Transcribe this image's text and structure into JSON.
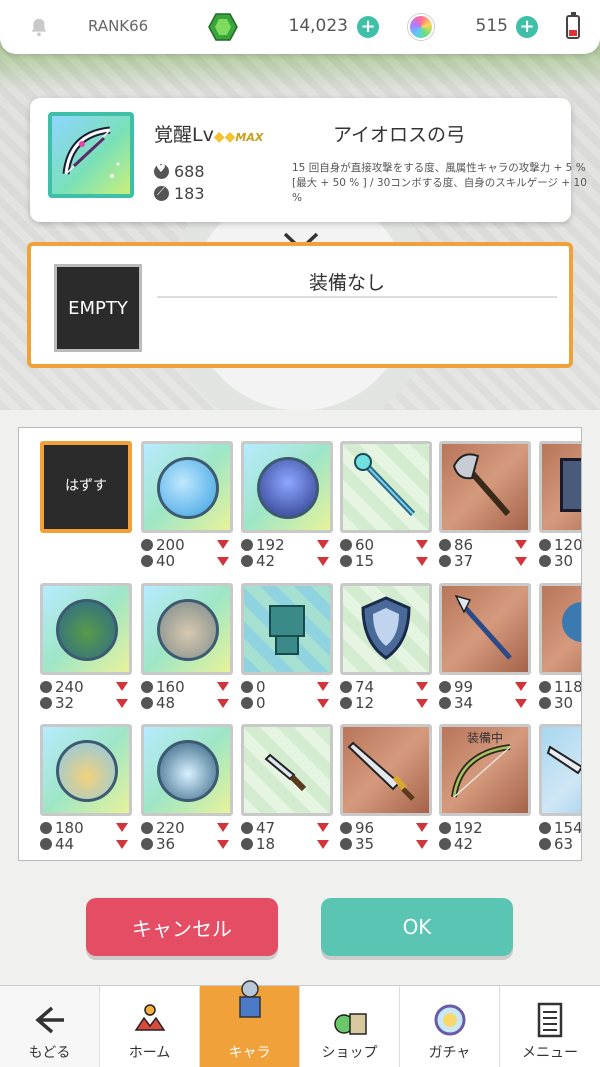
{
  "status_bar": {
    "rank_label": "RANK66",
    "gem_value": "14,023",
    "orb_value": "515",
    "plus_label": "+"
  },
  "item": {
    "awakening_prefix": "覚醒Lv",
    "awakening_max": "MAX",
    "name": "アイオロスの弓",
    "hp": "688",
    "attack": "183",
    "description": "15 回自身が直接攻撃をする度、風属性キャラの攻撃力 + 5 %[最大 + 50 % ] / 30コンボする度、自身のスキルゲージ + 10 %"
  },
  "equip_slot": {
    "empty_label": "EMPTY",
    "status": "装備なし"
  },
  "grid": {
    "remove_label": "はずす",
    "equipped_label": "装備中",
    "items": [
      {
        "hp": "200",
        "atk": "40"
      },
      {
        "hp": "192",
        "atk": "42"
      },
      {
        "hp": "60",
        "atk": "15"
      },
      {
        "hp": "86",
        "atk": "37"
      },
      {
        "hp": "120",
        "atk": "30"
      },
      {
        "hp": "240",
        "atk": "32"
      },
      {
        "hp": "160",
        "atk": "48"
      },
      {
        "hp": "0",
        "atk": "0"
      },
      {
        "hp": "74",
        "atk": "12"
      },
      {
        "hp": "99",
        "atk": "34"
      },
      {
        "hp": "118",
        "atk": "30"
      },
      {
        "hp": "180",
        "atk": "44"
      },
      {
        "hp": "220",
        "atk": "36"
      },
      {
        "hp": "47",
        "atk": "18"
      },
      {
        "hp": "96",
        "atk": "35"
      },
      {
        "hp": "192",
        "atk": "42"
      },
      {
        "hp": "154",
        "atk": "63"
      }
    ]
  },
  "buttons": {
    "cancel": "キャンセル",
    "ok": "OK"
  },
  "nav": {
    "back": "もどる",
    "home": "ホーム",
    "chara": "キャラ",
    "shop": "ショップ",
    "gacha": "ガチャ",
    "menu": "メニュー"
  },
  "colors": {
    "accent_orange": "#f0a13a",
    "teal": "#3fbfa8",
    "cancel_red": "#e54d64",
    "ok_teal": "#5bc5b4",
    "down_arrow_red": "#d2343c"
  }
}
